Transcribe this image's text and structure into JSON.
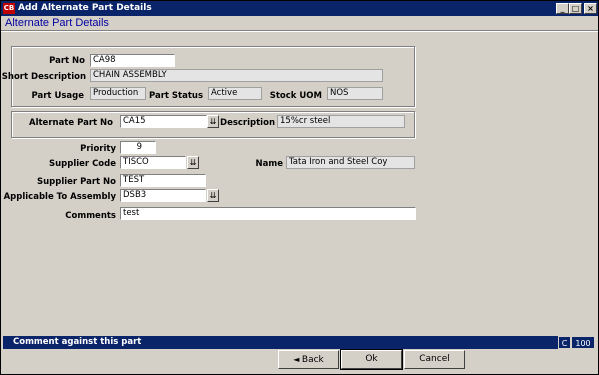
{
  "window": {
    "title": "Add Alternate Part Details",
    "icon_text": "CB"
  },
  "heading": "Alternate Part Details",
  "part": {
    "part_no_label": "Part No",
    "part_no": "CA98",
    "short_desc_label": "Short Description",
    "short_desc": "CHAIN ASSEMBLY",
    "usage_label": "Part Usage",
    "usage": "Production",
    "status_label": "Part Status",
    "status": "Active",
    "uom_label": "Stock UOM",
    "uom": "NOS"
  },
  "alternate": {
    "alt_part_label": "Alternate Part No",
    "alt_part": "CA15",
    "desc_label": "Description",
    "desc": "15%cr steel"
  },
  "supplier": {
    "priority_label": "Priority",
    "priority": "9",
    "code_label": "Supplier Code",
    "code": "TISCO",
    "name_label": "Name",
    "name": "Tata Iron and Steel Coy",
    "part_no_label": "Supplier Part No",
    "part_no": "TEST",
    "assembly_label": "Applicable To Assembly",
    "assembly": "DSB3",
    "comments_label": "Comments",
    "comments": "test"
  },
  "status_text": "Comment against this part",
  "indicators": {
    "mode": "C",
    "value": "100"
  },
  "buttons": {
    "back": "Back",
    "ok": "Ok",
    "cancel": "Cancel"
  },
  "colors": {
    "titlebar": "#0a246a",
    "heading": "#0000a0",
    "background": "#d4d0c8"
  }
}
